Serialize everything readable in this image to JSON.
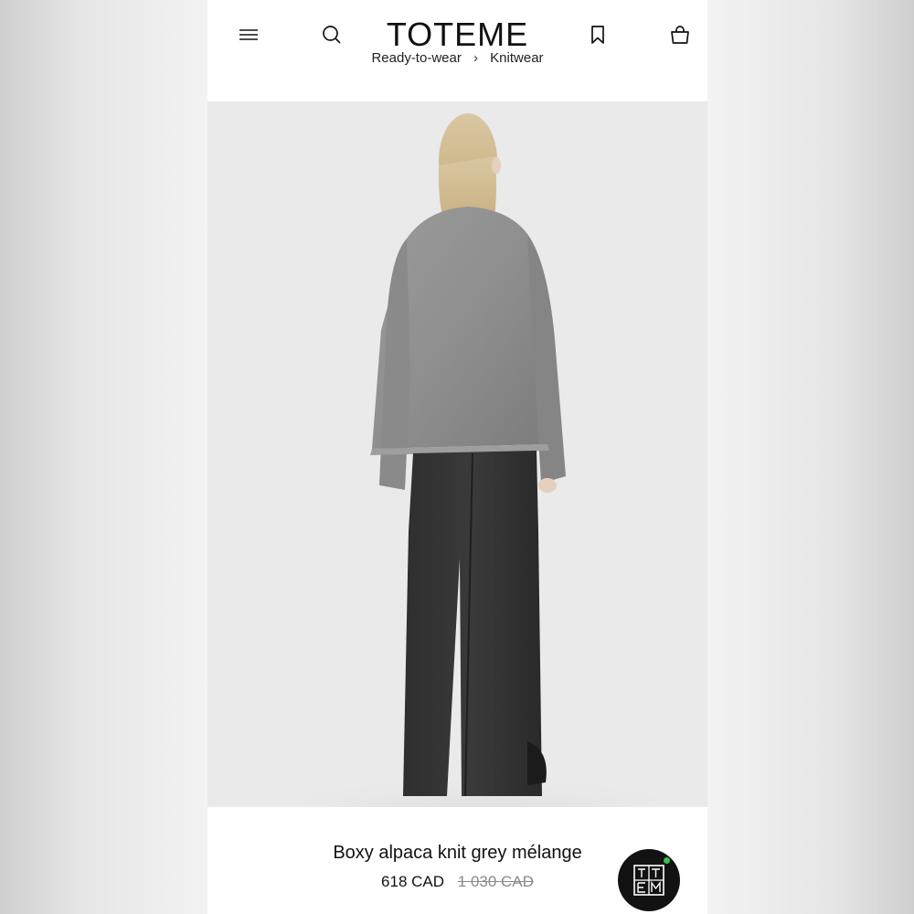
{
  "brand": "TOTEME",
  "breadcrumb": {
    "items": [
      "Ready-to-wear",
      "Knitwear"
    ],
    "separator": "›"
  },
  "header_icons": [
    "menu-icon",
    "search-icon",
    "bookmark-icon",
    "bag-icon"
  ],
  "product": {
    "name": "Boxy alpaca knit grey mélange",
    "price": "618 CAD",
    "original_price": "1 030 CAD",
    "image_alt": "Model wearing grey alpaca knit and dark trousers, back view"
  },
  "chat_badge": {
    "icon": "toteme-monogram-icon",
    "status_color": "#36c24a"
  }
}
